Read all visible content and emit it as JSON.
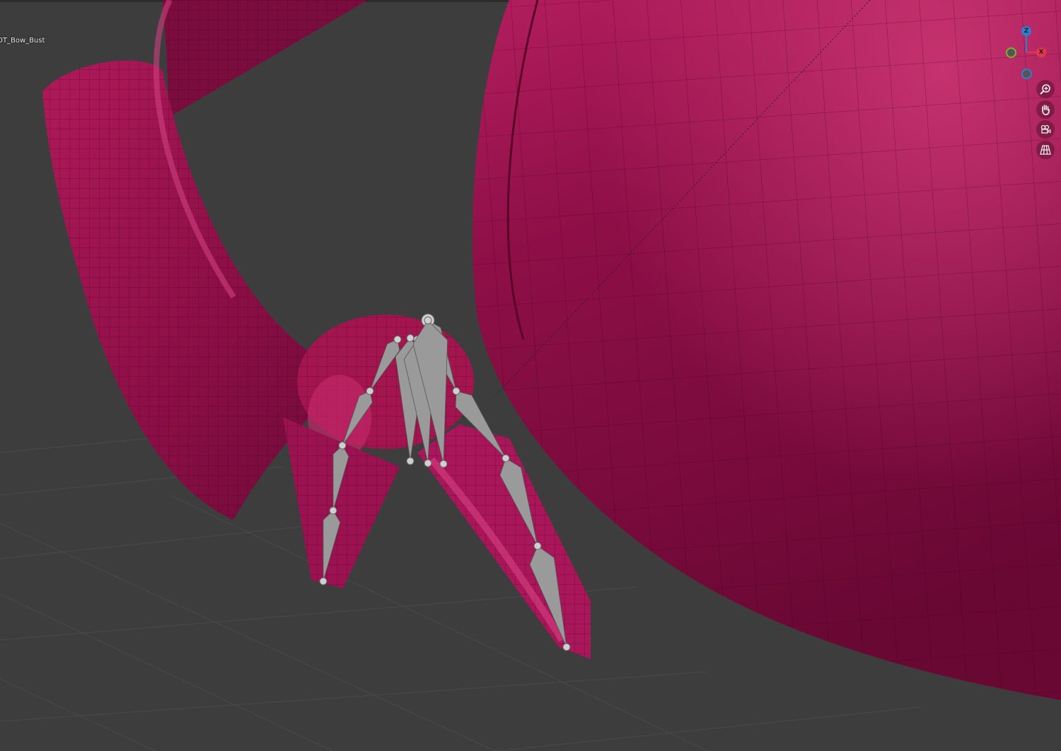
{
  "viewport": {
    "object_label": "OT_Bow_Bust",
    "colors": {
      "background": "#3d3d3d",
      "mesh": "#b01a5a",
      "bones": "#9a9a9a"
    }
  },
  "gizmo": {
    "z_label": "Z",
    "x_label": "X",
    "colors": {
      "x": "#e4374d",
      "y": "#7bb32e",
      "z": "#2f7fd0"
    }
  },
  "nav_buttons": [
    {
      "name": "zoom",
      "icon": "magnifier-plus-icon"
    },
    {
      "name": "pan",
      "icon": "hand-icon"
    },
    {
      "name": "camera",
      "icon": "camera-icon"
    },
    {
      "name": "perspective",
      "icon": "grid-icon"
    }
  ]
}
